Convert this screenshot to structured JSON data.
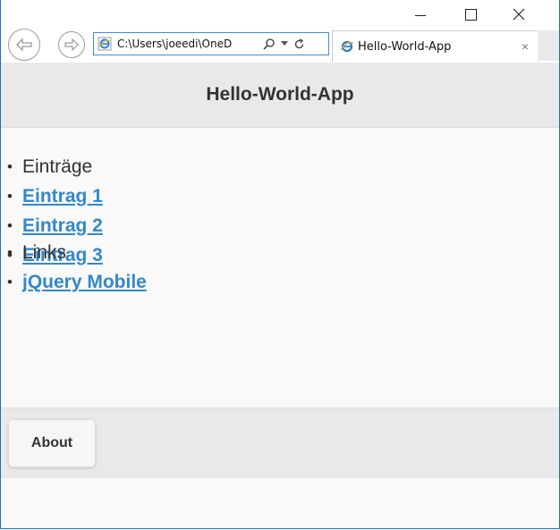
{
  "window": {
    "controls": {
      "minimize": "minimize",
      "maximize": "maximize",
      "close": "close"
    }
  },
  "browser": {
    "address": "C:\\Users\\joeedi\\OneD",
    "tab_title": "Hello-World-App",
    "tab_close": "×"
  },
  "app": {
    "title": "Hello-World-App",
    "list1": {
      "header": "Einträge",
      "items": [
        "Eintrag 1",
        "Eintrag 2",
        "Eintrag 3"
      ]
    },
    "list2": {
      "header": "Links",
      "items": [
        "jQuery Mobile"
      ]
    },
    "footer": {
      "about_label": "About"
    }
  },
  "colors": {
    "link": "#3388cc",
    "header_bg": "#e9e9e9",
    "page_bg": "#f9f9f9",
    "window_border": "#1e6fc1"
  }
}
